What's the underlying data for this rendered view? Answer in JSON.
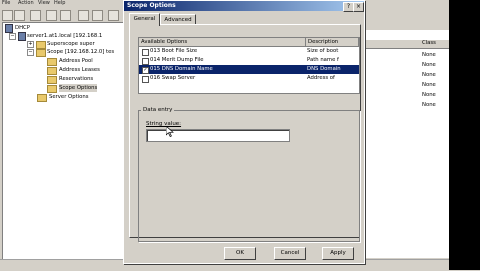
{
  "mmc": {
    "menu": [
      "File",
      "Action",
      "View",
      "Help"
    ],
    "tree": [
      {
        "label": "DHCP",
        "indent": 0
      },
      {
        "label": "server1.at1.local [192.168.1",
        "indent": 1
      },
      {
        "label": "Superscope super",
        "indent": 2
      },
      {
        "label": "Scope [192.168.12.0] tes",
        "indent": 2
      },
      {
        "label": "Address Pool",
        "indent": 3
      },
      {
        "label": "Address Leases",
        "indent": 3
      },
      {
        "label": "Reservations",
        "indent": 3
      },
      {
        "label": "Scope Options",
        "indent": 3
      },
      {
        "label": "Server Options",
        "indent": 2
      }
    ],
    "right_header": "Class",
    "right_values": [
      "None",
      "None",
      "None",
      "None",
      "None",
      "None"
    ]
  },
  "dialog": {
    "title": "Scope Options",
    "tabs": [
      "General",
      "Advanced"
    ],
    "list_label": "Available Options",
    "col_name": "Available Options",
    "col_desc": "Description",
    "options": [
      {
        "checked": false,
        "name": "013 Boot File Size",
        "desc": "Size of boot"
      },
      {
        "checked": false,
        "name": "014 Merit Dump File",
        "desc": "Path name f"
      },
      {
        "checked": true,
        "name": "015 DNS Domain Name",
        "desc": "DNS Domain"
      },
      {
        "checked": false,
        "name": "016 Swap Server",
        "desc": "Address of"
      }
    ],
    "data_entry_label": "Data entry",
    "string_value_label": "String value:",
    "string_value": "",
    "buttons": {
      "ok": "OK",
      "cancel": "Cancel",
      "apply": "Apply"
    },
    "close_glyph": "×",
    "help_glyph": "?"
  }
}
